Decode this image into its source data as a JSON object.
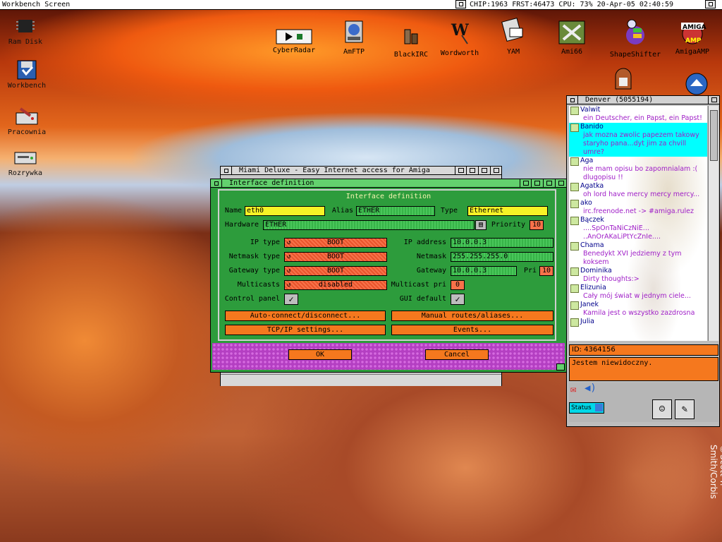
{
  "screen": {
    "title": "Workbench Screen",
    "status": "CHIP:1963 FRST:46473 CPU: 73% 20-Apr-05 02:40:59"
  },
  "desktop_icons_left": [
    {
      "label": "Ram Disk",
      "icon": "chip-icon"
    },
    {
      "label": "Workbench",
      "icon": "disk-icon"
    },
    {
      "label": "Pracownia",
      "icon": "drive-icon"
    },
    {
      "label": "Rozrywka",
      "icon": "drive-icon"
    }
  ],
  "desktop_icons_top": [
    {
      "label": "CyberRadar",
      "icon": "radar-icon"
    },
    {
      "label": "AmFTP",
      "icon": "ftp-icon"
    },
    {
      "label": "BlackIRC",
      "icon": "irc-icon"
    },
    {
      "label": "Wordworth",
      "icon": "pen-icon"
    },
    {
      "label": "YAM",
      "icon": "mail-icon"
    },
    {
      "label": "Ami66",
      "icon": "tools-icon"
    },
    {
      "label": "ShapeShifter",
      "icon": "apple-icon"
    },
    {
      "label": "AmigaAMP",
      "icon": "amp-icon"
    }
  ],
  "copyright": "©Scott T. Smith/Corbis",
  "miami_window": {
    "title": "Miami Deluxe - Easy Internet access for Amiga"
  },
  "interface_window": {
    "title": "Interface definition",
    "group_title": "Interface definition",
    "name_label": "Name",
    "name_value": "eth0",
    "alias_label": "Alias",
    "alias_value": "ETHER",
    "type_label": "Type",
    "type_value": "Ethernet",
    "hardware_label": "Hardware",
    "hardware_value": "ETHER",
    "priority_label": "Priority",
    "priority_value": "10",
    "ip_type_label": "IP type",
    "ip_type_value": "BOOT",
    "ip_address_label": "IP address",
    "ip_address_value": "10.0.0.3",
    "netmask_type_label": "Netmask type",
    "netmask_type_value": "BOOT",
    "netmask_label": "Netmask",
    "netmask_value": "255.255.255.0",
    "gateway_type_label": "Gateway type",
    "gateway_type_value": "BOOT",
    "gateway_label": "Gateway",
    "gateway_value": "10.0.0.3",
    "gateway_pri_label": "Pri",
    "gateway_pri_value": "10",
    "multicasts_label": "Multicasts",
    "multicasts_value": "disabled",
    "multicast_pri_label": "Multicast pri",
    "multicast_pri_value": "0",
    "control_panel_label": "Control panel",
    "control_panel_checked": true,
    "gui_default_label": "GUI default",
    "gui_default_checked": true,
    "auto_connect_button": "Auto-connect/disconnect...",
    "manual_routes_button": "Manual routes/aliases...",
    "tcpip_button": "TCP/IP settings...",
    "events_button": "Events...",
    "ok_button": "OK",
    "cancel_button": "Cancel"
  },
  "chat_window": {
    "title": "Denver (5055194)",
    "messages": [
      {
        "nick": "Valwit",
        "text": "ein Deutscher, ein Papst, ein Papst!",
        "highlight": false
      },
      {
        "nick": "Banido",
        "text": "jak mozna zwolic papezem takowy staryho pana...dyt jim za chvill umre?",
        "highlight": true
      },
      {
        "nick": "Aga",
        "text": "nie mam opisu bo zapomnialam :( dlugopisu !!",
        "highlight": false
      },
      {
        "nick": "Agatka",
        "text": "oh lord have mercy mercy mercy...",
        "highlight": false
      },
      {
        "nick": "ako",
        "text": "irc.freenode.net -> #amiga.rulez",
        "highlight": false
      },
      {
        "nick": "Bączek",
        "text": "....SpOnTaNiCzNiE... ..AnOrAKaLiPtYcZnIe....",
        "highlight": false
      },
      {
        "nick": "Chama",
        "text": "Benedykt XVI jedziemy z tym koksem",
        "highlight": false
      },
      {
        "nick": "Dominika",
        "text": "Dirty thoughts:>",
        "highlight": false
      },
      {
        "nick": "Elizunia",
        "text": "Cały mój świat w jednym ciele...",
        "highlight": false
      },
      {
        "nick": "Janek",
        "text": "Kamila jest o wszystko zazdrosna",
        "highlight": false
      },
      {
        "nick": "Julia",
        "text": "",
        "highlight": false
      }
    ],
    "id_text": "ID: 4364156",
    "status_message": "Jestem niewidoczny.",
    "status_label": "Status"
  }
}
